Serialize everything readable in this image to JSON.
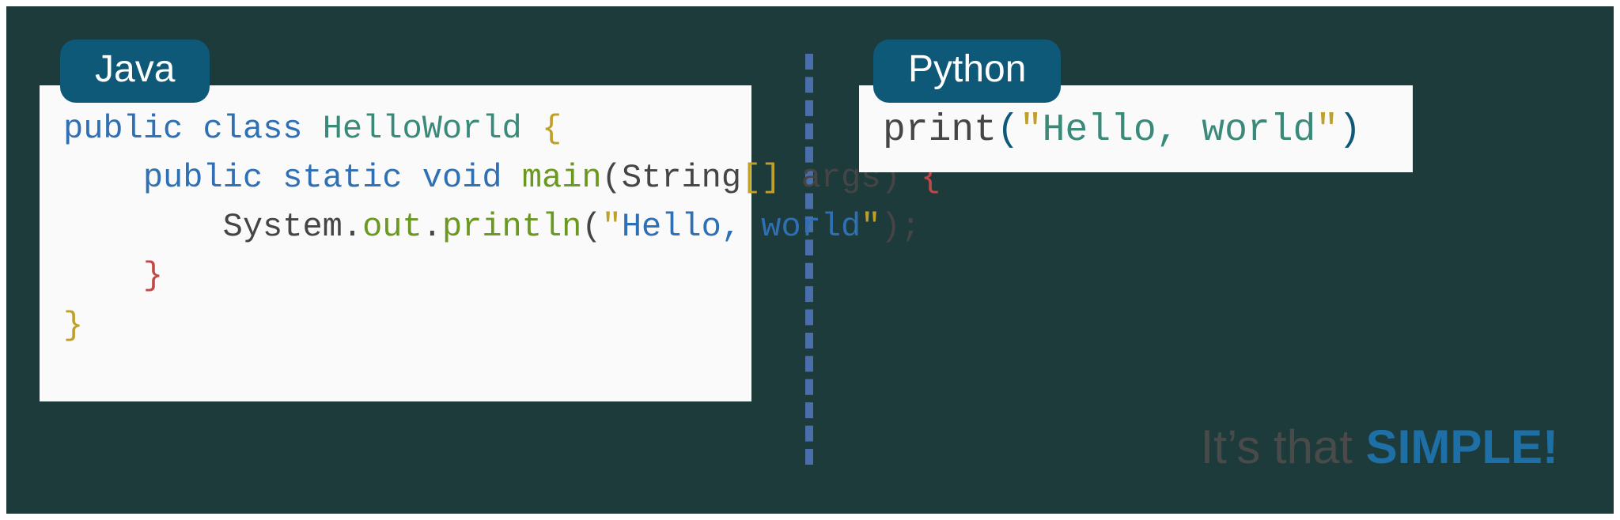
{
  "java": {
    "label": "Java",
    "code": {
      "kw_public1": "public",
      "kw_class": "class",
      "cls_name": "HelloWorld",
      "brace_open1": "{",
      "kw_public2": "public",
      "kw_static": "static",
      "kw_void": "void",
      "fn_main": "main",
      "arg_type": "String",
      "arg_brackets": "[]",
      "arg_name": "args",
      "brace_open2": "{",
      "sys": "System",
      "dot1": ".",
      "out": "out",
      "dot2": ".",
      "println": "println",
      "q1": "\"",
      "str": "Hello, world",
      "q2": "\"",
      "semi": ";",
      "brace_close2": "}",
      "brace_close1": "}"
    }
  },
  "python": {
    "label": "Python",
    "code": {
      "fn_print": "print",
      "par_open": "(",
      "q1": "\"",
      "str": "Hello, world",
      "q2": "\"",
      "par_close": ")"
    }
  },
  "tagline": {
    "prefix": "It’s that ",
    "emphasis": "SIMPLE",
    "bang": "!"
  }
}
